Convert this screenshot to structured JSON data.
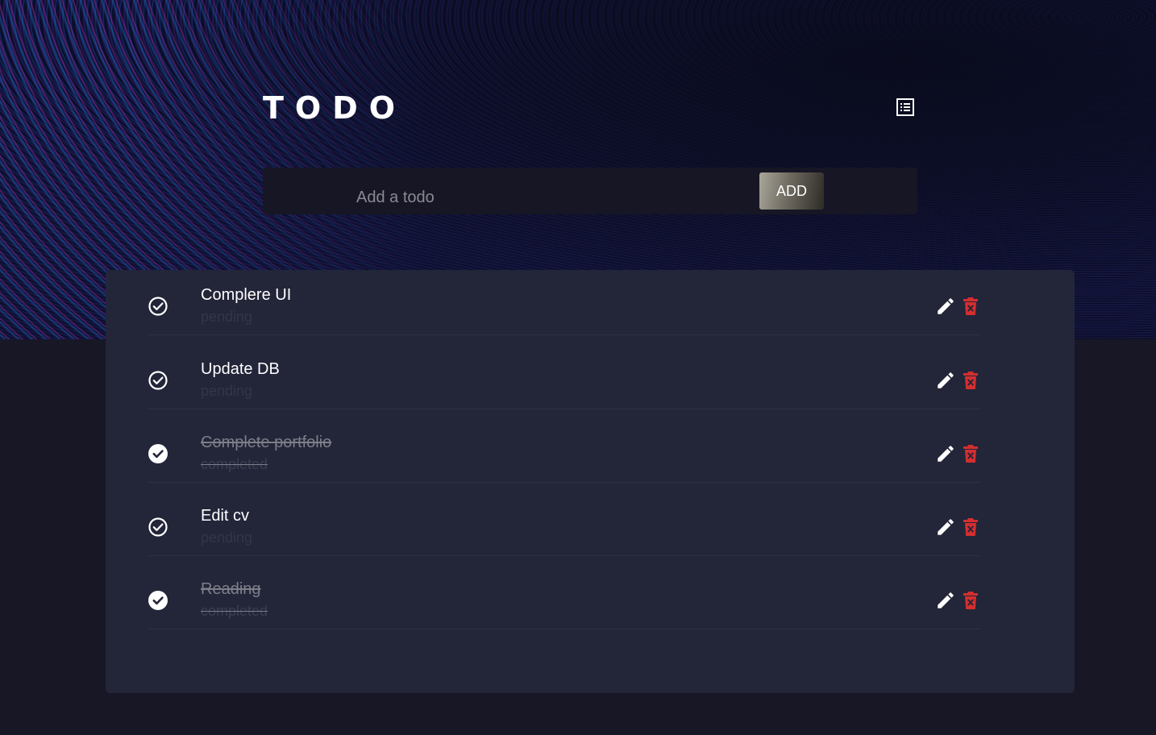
{
  "header": {
    "title": "TODO"
  },
  "new_todo": {
    "placeholder": "Add a todo",
    "value": "",
    "add_label": "ADD"
  },
  "todos": [
    {
      "title": "Complere UI",
      "status": "pending",
      "completed": false
    },
    {
      "title": "Update DB",
      "status": "pending",
      "completed": false
    },
    {
      "title": "Complete portfolio",
      "status": "completed",
      "completed": true
    },
    {
      "title": "Edit cv",
      "status": "pending",
      "completed": false
    },
    {
      "title": "Reading",
      "status": "completed",
      "completed": true
    }
  ],
  "icons": {
    "header": "list-icon",
    "pending": "check-circle-outline-icon",
    "completed": "check-circle-filled-icon",
    "edit": "pencil-icon",
    "delete": "trash-icon"
  },
  "colors": {
    "page_background": "#171726",
    "card_background": "#232539",
    "input_background": "#161624",
    "delete_icon": "#d32f2f",
    "text_primary": "#ffffff",
    "text_completed": "#7d7e89"
  }
}
